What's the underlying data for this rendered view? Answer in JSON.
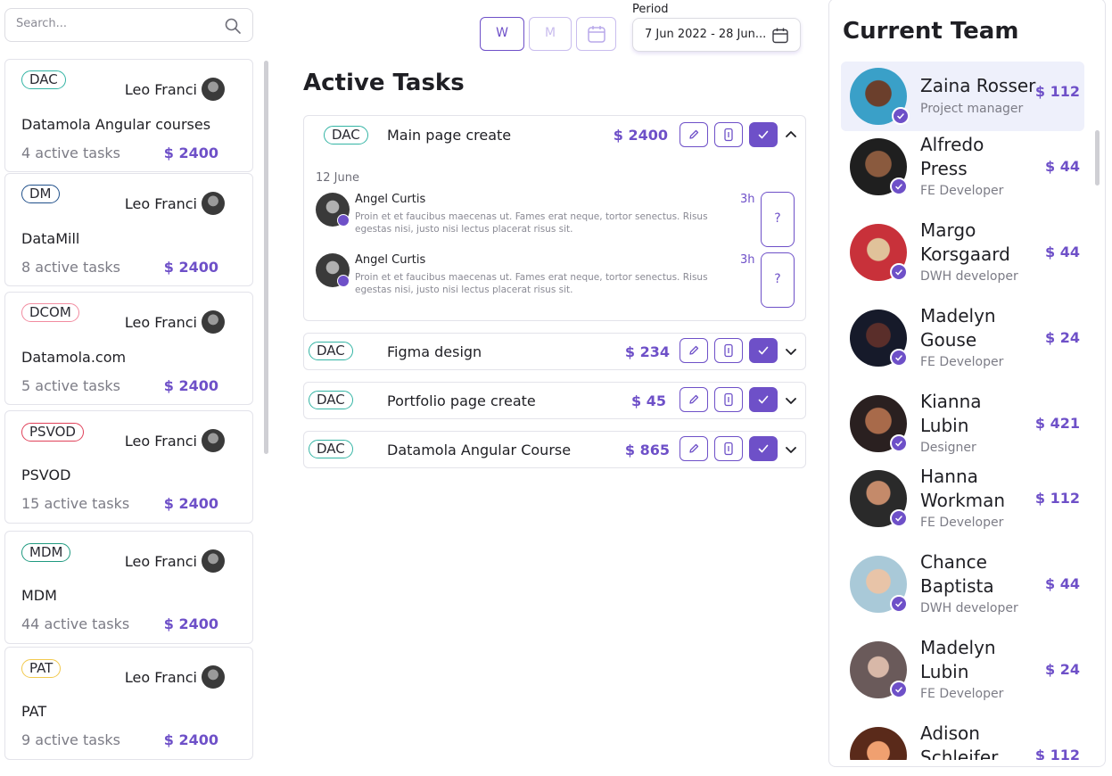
{
  "search": {
    "placeholder": "Search..."
  },
  "colors": {
    "accent": "#6e50c8"
  },
  "projects": [
    {
      "tag": "DAC",
      "tag_color": "#33b4a4",
      "owner": "Leo Franci",
      "name": "Datamola Angular courses",
      "tasks": "4 active tasks",
      "amount": "$ 2400"
    },
    {
      "tag": "DM",
      "tag_color": "#1f4f8a",
      "owner": "Leo Franci",
      "name": "DataMill",
      "tasks": "8 active tasks",
      "amount": "$ 2400"
    },
    {
      "tag": "DCOM",
      "tag_color": "#f28ca0",
      "owner": "Leo Franci",
      "name": "Datamola.com",
      "tasks": "5 active tasks",
      "amount": "$ 2400"
    },
    {
      "tag": "PSVOD",
      "tag_color": "#e0415a",
      "owner": "Leo Franci",
      "name": "PSVOD",
      "tasks": "15 active tasks",
      "amount": "$ 2400"
    },
    {
      "tag": "MDM",
      "tag_color": "#1f9a80",
      "owner": "Leo Franci",
      "name": "MDM",
      "tasks": "44 active tasks",
      "amount": "$ 2400"
    },
    {
      "tag": "PAT",
      "tag_color": "#f2c94c",
      "owner": "Leo Franci",
      "name": "PAT",
      "tasks": "9 active tasks",
      "amount": "$ 2400"
    }
  ],
  "view_toggle": {
    "week": "W",
    "month": "M",
    "calendar_icon": "calendar-icon"
  },
  "period": {
    "label": "Period",
    "value": "7 Jun 2022 - 28 Jun..."
  },
  "active_tasks": {
    "title": "Active Tasks",
    "tasks": [
      {
        "tag": "DAC",
        "name": "Main page create",
        "amount": "$ 2400",
        "expanded": true,
        "date": "12 June",
        "comments": [
          {
            "author": "Angel Curtis",
            "time": "3h",
            "text": "Proin et et faucibus maecenas ut. Fames erat neque, tortor senectus. Risus egestas nisi, justo nisi lectus placerat risus sit.",
            "action": "?"
          },
          {
            "author": "Angel Curtis",
            "time": "3h",
            "text": "Proin et et faucibus maecenas ut. Fames erat neque, tortor senectus. Risus egestas nisi, justo nisi lectus placerat risus sit.",
            "action": "?"
          }
        ]
      },
      {
        "tag": "DAC",
        "name": "Figma design",
        "amount": "$ 234",
        "expanded": false
      },
      {
        "tag": "DAC",
        "name": "Portfolio page create",
        "amount": "$ 45",
        "expanded": false
      },
      {
        "tag": "DAC",
        "name": "Datamola Angular Course",
        "amount": "$ 865",
        "expanded": false
      }
    ]
  },
  "team": {
    "title": "Current Team",
    "members": [
      {
        "name": "Zaina Rosser",
        "role": "Project manager",
        "rate": "$ 112",
        "selected": true,
        "avatar_color": "#3aa0c8"
      },
      {
        "name": "Alfredo Press",
        "role": "FE Developer",
        "rate": "$ 44",
        "avatar_color": "#2e2e2e"
      },
      {
        "name": "Margo Korsgaard",
        "role": "DWH developer",
        "rate": "$ 44",
        "avatar_color": "#c83a3a"
      },
      {
        "name": "Madelyn Gouse",
        "role": "FE Developer",
        "rate": "$ 24",
        "avatar_color": "#1e2a40"
      },
      {
        "name": "Kianna Lubin",
        "role": "Designer",
        "rate": "$ 421",
        "avatar_color": "#5a3a2a"
      },
      {
        "name": "Hanna Workman",
        "role": "FE Developer",
        "rate": "$ 112",
        "avatar_color": "#7a4a3a"
      },
      {
        "name": "Chance Baptista",
        "role": "DWH developer",
        "rate": "$ 44",
        "avatar_color": "#a9c9d8"
      },
      {
        "name": "Madelyn Lubin",
        "role": "FE Developer",
        "rate": "$ 24",
        "avatar_color": "#b0a8a8"
      },
      {
        "name": "Adison Schleifer",
        "role": "",
        "rate": "$ 112",
        "avatar_color": "#c86a3a"
      }
    ]
  }
}
